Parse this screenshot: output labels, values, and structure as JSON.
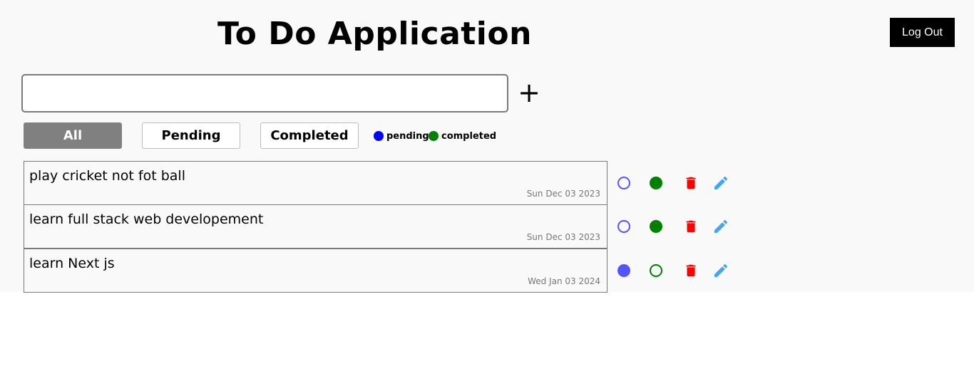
{
  "header": {
    "title": "To Do Application",
    "logout_label": "Log Out"
  },
  "new_task": {
    "value": "",
    "placeholder": "",
    "add_label": "+"
  },
  "filters": [
    {
      "label": "All",
      "active": true
    },
    {
      "label": "Pending",
      "active": false
    },
    {
      "label": "Completed",
      "active": false
    }
  ],
  "legend": {
    "pending": {
      "label": "pending",
      "color": "#0000ff"
    },
    "completed": {
      "label": "completed",
      "color": "#008000"
    }
  },
  "tasks": [
    {
      "text": "play cricket not fot ball",
      "date": "Sun Dec 03 2023",
      "status": "completed"
    },
    {
      "text": "learn full stack web developement",
      "date": "Sun Dec 03 2023",
      "status": "completed"
    },
    {
      "text": "learn Next js",
      "date": "Wed Jan 03 2024",
      "status": "pending"
    }
  ],
  "icons": {
    "delete": "trash-icon",
    "edit": "pencil-icon"
  },
  "colors": {
    "pending_ring": "#5555ff",
    "completed": "#008000",
    "delete": "#ff0000",
    "edit": "#42a5f5",
    "active_filter": "#808080"
  }
}
